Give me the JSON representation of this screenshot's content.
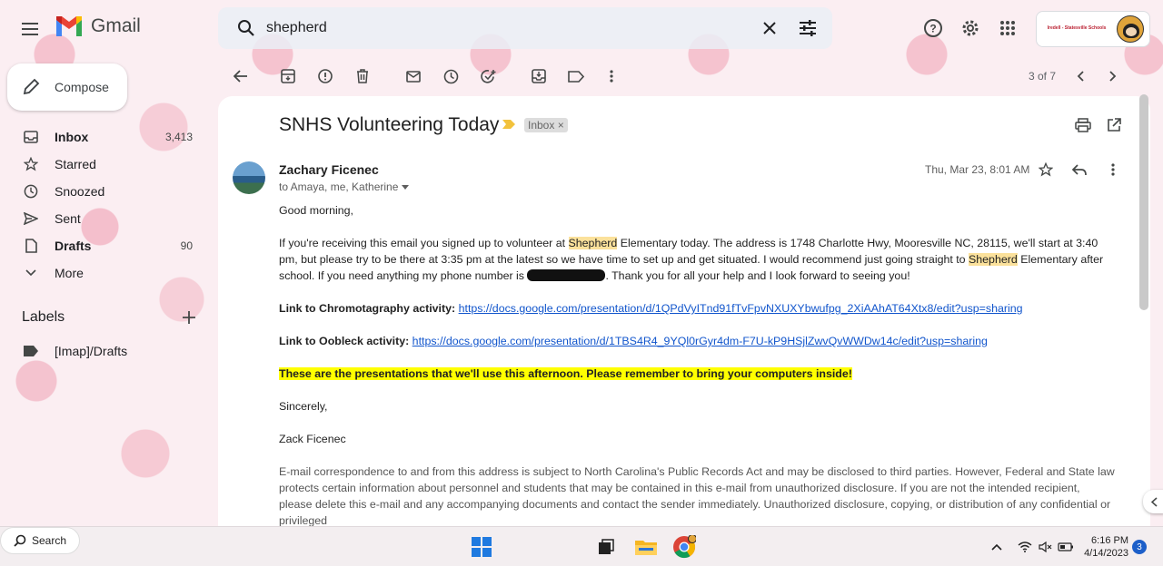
{
  "app": {
    "name": "Gmail"
  },
  "search": {
    "query": "shepherd"
  },
  "account": {
    "org_logo_title": "Iredell - Statesville Schools",
    "org_logo_subtitle": ""
  },
  "compose_label": "Compose",
  "nav": [
    {
      "label": "Inbox",
      "count": "3,413",
      "icon": "inbox-icon",
      "bold": true
    },
    {
      "label": "Starred",
      "count": "",
      "icon": "star-icon",
      "bold": false
    },
    {
      "label": "Snoozed",
      "count": "",
      "icon": "clock-icon",
      "bold": false
    },
    {
      "label": "Sent",
      "count": "",
      "icon": "send-icon",
      "bold": false
    },
    {
      "label": "Drafts",
      "count": "90",
      "icon": "draft-icon",
      "bold": true
    },
    {
      "label": "More",
      "count": "",
      "icon": "chevron-down-icon",
      "bold": false
    }
  ],
  "labels": {
    "title": "Labels",
    "items": [
      {
        "label": "[Imap]/Drafts"
      }
    ]
  },
  "toolbar": {
    "pager": "3 of 7"
  },
  "email": {
    "subject": "SNHS Volunteering Today",
    "chip": "Inbox",
    "sender": "Zachary Ficenec",
    "recipients": "to Amaya, me, Katherine",
    "date": "Thu, Mar 23, 8:01 AM",
    "greeting": "Good morning,",
    "p1a": "If you're receiving this email you signed up to volunteer at ",
    "hl1": "Shepherd",
    "p1b": " Elementary today. The address is 1748 Charlotte Hwy, Mooresville NC, 28115, we'll start at 3:40 pm, but please try to be there at 3:35 pm at the latest so we have time to set up and get situated. I would recommend just going straight to ",
    "hl2": "Shepherd",
    "p1c": " Elementary after school. If you need anything my phone number is ",
    "p1d": ". Thank you for all your help and I look forward to seeing you!",
    "link1_label": "Link to Chromotagraphy activity:",
    "link1_url": "https://docs.google.com/presentation/d/1QPdVyITnd91fTvFpvNXUXYbwufpg_2XiAAhAT64Xtx8/edit?usp=sharing",
    "link2_label": "Link to Oobleck activity:",
    "link2_url": "https://docs.google.com/presentation/d/1TBS4R4_9YQl0rGyr4dm-F7U-kP9HSjlZwvQvWWDw14c/edit?usp=sharing",
    "highlight_note": "These are the presentations that we'll use this afternoon. Please remember to bring your computers inside!",
    "signoff": "Sincerely,",
    "signature": "Zack Ficenec",
    "disclaimer": "E-mail correspondence to and from this address is subject to North Carolina's Public Records Act and may be disclosed to third parties. However, Federal and State law protects certain information about personnel and students that may be contained in this e-mail from unauthorized disclosure. If you are not the intended recipient, please delete this e-mail and any accompanying documents and contact the sender immediately. Unauthorized disclosure, copying, or distribution of any confidential or privileged"
  },
  "taskbar": {
    "search_label": "Search",
    "time": "6:16 PM",
    "date": "4/14/2023",
    "notifications": "3"
  },
  "colors": {
    "accent": "#1155cc",
    "highlight": "#ffff00",
    "search_hit": "#fbe19b",
    "background": "#fbeef2"
  }
}
